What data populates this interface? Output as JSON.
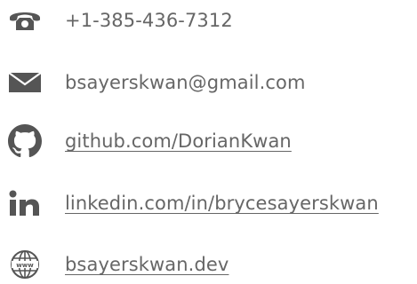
{
  "contacts": [
    {
      "icon": "phone-icon",
      "text": "+1-385-436-7312",
      "link": false
    },
    {
      "icon": "envelope-icon",
      "text": "bsayerskwan@gmail.com",
      "link": false
    },
    {
      "icon": "github-icon",
      "text": "github.com/DorianKwan",
      "link": true
    },
    {
      "icon": "linkedin-icon",
      "text": "linkedin.com/in/brycesayerskwan",
      "link": true
    },
    {
      "icon": "globe-www-icon",
      "text": "bsayerskwan.dev",
      "link": true
    }
  ],
  "colors": {
    "text": "#666666",
    "icon": "#555555"
  }
}
